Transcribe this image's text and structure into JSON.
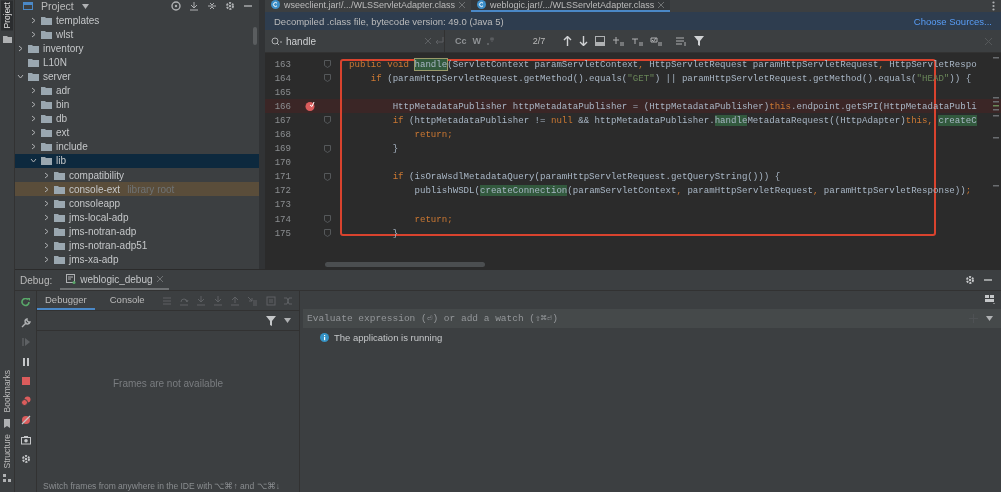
{
  "side_strip": {
    "top": [
      {
        "label": "Project",
        "selected": true
      }
    ],
    "bottom": [
      {
        "label": "Bookmarks",
        "selected": false
      },
      {
        "label": "Structure",
        "selected": false
      }
    ]
  },
  "project": {
    "title": "Project",
    "tree": [
      {
        "children": [
          {
            "label": "templates",
            "expandable": true,
            "expanded": false,
            "selected": false,
            "highlighted": false
          },
          {
            "label": "wlst",
            "expandable": true,
            "expanded": false,
            "selected": false,
            "highlighted": false
          }
        ]
      },
      {
        "label": "inventory",
        "expandable": true,
        "expanded": false,
        "selected": false,
        "highlighted": false
      },
      {
        "label": "L10N",
        "expandable": false,
        "selected": false,
        "highlighted": false
      },
      {
        "label": "server",
        "expandable": true,
        "expanded": true,
        "selected": false,
        "highlighted": false,
        "children": [
          {
            "label": "adr",
            "expandable": true,
            "expanded": false,
            "selected": false,
            "highlighted": false
          },
          {
            "label": "bin",
            "expandable": true,
            "expanded": false,
            "selected": false,
            "highlighted": false
          },
          {
            "label": "db",
            "expandable": true,
            "expanded": false,
            "selected": false,
            "highlighted": false
          },
          {
            "label": "ext",
            "expandable": true,
            "expanded": false,
            "selected": false,
            "highlighted": false
          },
          {
            "label": "include",
            "expandable": true,
            "expanded": false,
            "selected": false,
            "highlighted": false
          },
          {
            "label": "lib",
            "expandable": true,
            "expanded": true,
            "selected": true,
            "highlighted": false,
            "children": [
              {
                "label": "compatibility",
                "expandable": true,
                "expanded": false,
                "selected": false,
                "highlighted": false
              },
              {
                "label": "console-ext",
                "note": "library root",
                "expandable": true,
                "expanded": false,
                "selected": false,
                "highlighted": true
              },
              {
                "label": "consoleapp",
                "expandable": true,
                "expanded": false,
                "selected": false,
                "highlighted": false
              },
              {
                "label": "jms-local-adp",
                "expandable": true,
                "expanded": false,
                "selected": false,
                "highlighted": false
              },
              {
                "label": "jms-notran-adp",
                "expandable": true,
                "expanded": false,
                "selected": false,
                "highlighted": false
              },
              {
                "label": "jms-notran-adp51",
                "expandable": true,
                "expanded": false,
                "selected": false,
                "highlighted": false
              },
              {
                "label": "jms-xa-adp",
                "expandable": true,
                "expanded": false,
                "selected": false,
                "highlighted": false
              }
            ]
          }
        ]
      }
    ]
  },
  "editor": {
    "tabs": [
      {
        "label": "wseeclient.jar!/.../WLSServletAdapter.class",
        "selected": false
      },
      {
        "label": "weblogic.jar!/.../WLSServletAdapter.class",
        "selected": true
      }
    ],
    "banner": {
      "text": "Decompiled .class file, bytecode version: 49.0 (Java 5)",
      "link": "Choose Sources..."
    },
    "search": {
      "value": "handle",
      "options": [
        "Cc",
        "W"
      ],
      "count": "2/7"
    },
    "lines": [
      {
        "number": "163",
        "fold": true,
        "breakpoint": false,
        "tokens": [
          {
            "kind": "kw",
            "text": "public void "
          },
          {
            "kind": "current",
            "text": "handle"
          },
          {
            "kind": "plain",
            "text": "(ServletContext paramServletContext"
          },
          {
            "kind": "kw",
            "text": ", "
          },
          {
            "kind": "plain",
            "text": "HttpServletRequest paramHttpServletRequest"
          },
          {
            "kind": "kw",
            "text": ", "
          },
          {
            "kind": "plain",
            "text": "HttpServletRespo"
          }
        ]
      },
      {
        "number": "164",
        "fold": true,
        "breakpoint": false,
        "tokens": [
          {
            "kind": "kw",
            "text": "    if "
          },
          {
            "kind": "plain",
            "text": "(paramHttpServletRequest.getMethod().equals("
          },
          {
            "kind": "str",
            "text": "\"GET\""
          },
          {
            "kind": "plain",
            "text": ") || paramHttpServletRequest.getMethod().equals("
          },
          {
            "kind": "str",
            "text": "\"HEAD\""
          },
          {
            "kind": "plain",
            "text": ")) {"
          }
        ]
      },
      {
        "number": "165",
        "fold": false,
        "breakpoint": false
      },
      {
        "number": "166",
        "fold": false,
        "breakpoint": true,
        "tokens": [
          {
            "kind": "plain",
            "text": "        HttpMetadataPublisher httpMetadataPublisher = (HttpMetadataPublisher)"
          },
          {
            "kind": "kw",
            "text": "this"
          },
          {
            "kind": "plain",
            "text": ".endpoint.getSPI(HttpMetadataPubli"
          }
        ]
      },
      {
        "number": "167",
        "fold": true,
        "breakpoint": false,
        "tokens": [
          {
            "kind": "kw",
            "text": "        if "
          },
          {
            "kind": "plain",
            "text": "(httpMetadataPublisher != "
          },
          {
            "kind": "kw",
            "text": "null "
          },
          {
            "kind": "plain",
            "text": "&& httpMetadataPublisher."
          },
          {
            "kind": "match",
            "text": "handle"
          },
          {
            "kind": "plain",
            "text": "MetadataRequest((HttpAdapter)"
          },
          {
            "kind": "kw",
            "text": "this, "
          },
          {
            "kind": "match",
            "text": "createC"
          }
        ]
      },
      {
        "number": "168",
        "fold": false,
        "breakpoint": false,
        "tokens": [
          {
            "kind": "kw",
            "text": "            return;"
          }
        ]
      },
      {
        "number": "169",
        "fold": true,
        "breakpoint": false,
        "tokens": [
          {
            "kind": "plain",
            "text": "        }"
          }
        ]
      },
      {
        "number": "170",
        "fold": false,
        "breakpoint": false
      },
      {
        "number": "171",
        "fold": true,
        "breakpoint": false,
        "tokens": [
          {
            "kind": "kw",
            "text": "        if "
          },
          {
            "kind": "plain",
            "text": "(isOraWsdlMetadataQuery(paramHttpServletRequest.getQueryString())) {"
          }
        ]
      },
      {
        "number": "172",
        "fold": false,
        "breakpoint": false,
        "tokens": [
          {
            "kind": "plain",
            "text": "            publishWSDL("
          },
          {
            "kind": "match",
            "text": "createConnection"
          },
          {
            "kind": "plain",
            "text": "(paramServletContext"
          },
          {
            "kind": "kw",
            "text": ", "
          },
          {
            "kind": "plain",
            "text": "paramHttpServletRequest"
          },
          {
            "kind": "kw",
            "text": ", "
          },
          {
            "kind": "plain",
            "text": "paramHttpServletResponse))"
          },
          {
            "kind": "kw",
            "text": ";"
          }
        ]
      },
      {
        "number": "173",
        "fold": false,
        "breakpoint": false
      },
      {
        "number": "174",
        "fold": true,
        "breakpoint": false,
        "tokens": [
          {
            "kind": "kw",
            "text": "            return;"
          }
        ]
      },
      {
        "number": "175",
        "fold": true,
        "breakpoint": false,
        "tokens": [
          {
            "kind": "plain",
            "text": "        }"
          }
        ]
      }
    ]
  },
  "debug": {
    "label": "Debug:",
    "session": {
      "label": "weblogic_debug",
      "selected": true
    },
    "tabs": [
      {
        "label": "Debugger",
        "selected": true
      },
      {
        "label": "Console",
        "selected": false
      }
    ],
    "frames_message": "Frames are not available",
    "watch_placeholder": "Evaluate expression (⏎) or add a watch (⇧⌘⏎)",
    "status": "The application is running",
    "hint": "Switch frames from anywhere in the IDE with ⌥⌘↑ and ⌥⌘↓"
  }
}
